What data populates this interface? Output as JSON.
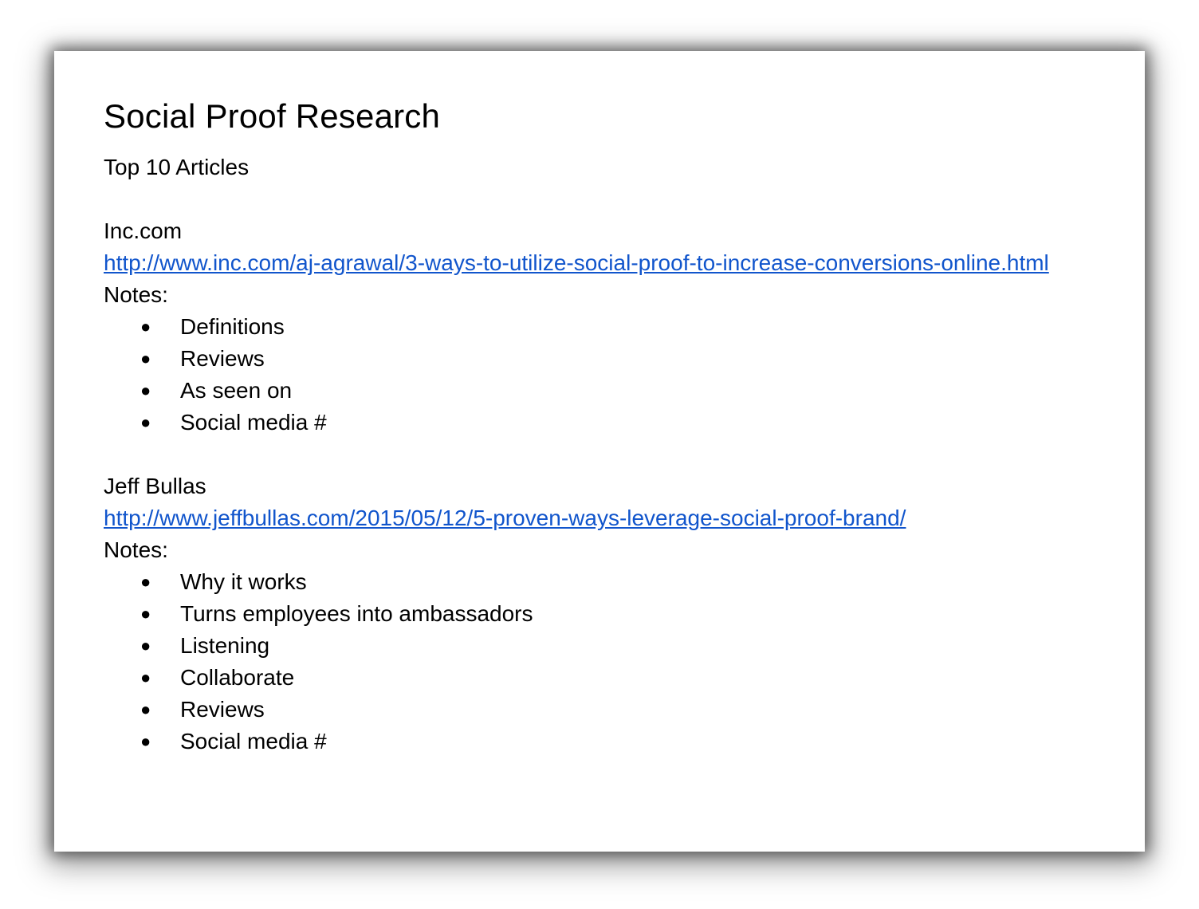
{
  "document": {
    "title": "Social Proof Research",
    "subtitle": "Top 10 Articles",
    "articles": [
      {
        "source": "Inc.com",
        "url": "http://www.inc.com/aj-agrawal/3-ways-to-utilize-social-proof-to-increase-conversions-online.html",
        "notes_label": "Notes:",
        "notes": [
          "Definitions",
          "Reviews",
          "As seen on",
          "Social media #"
        ]
      },
      {
        "source": "Jeff Bullas",
        "url": "http://www.jeffbullas.com/2015/05/12/5-proven-ways-leverage-social-proof-brand/",
        "notes_label": "Notes:",
        "notes": [
          "Why it works",
          "Turns employees into ambassadors",
          "Listening",
          "Collaborate",
          "Reviews",
          "Social media #"
        ]
      }
    ]
  },
  "icons": {
    "bullet": "●"
  },
  "colors": {
    "link": "#1155cc",
    "text": "#000000",
    "page": "#ffffff"
  }
}
